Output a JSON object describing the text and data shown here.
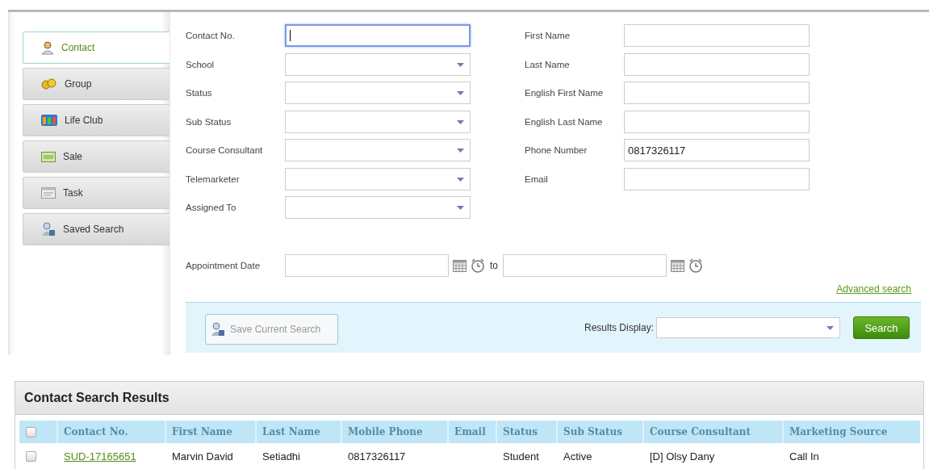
{
  "tabs": [
    {
      "label": "Contact",
      "selected": true
    },
    {
      "label": "Group",
      "selected": false
    },
    {
      "label": "Life Club",
      "selected": false
    },
    {
      "label": "Sale",
      "selected": false
    },
    {
      "label": "Task",
      "selected": false
    },
    {
      "label": "Saved Search",
      "selected": false
    }
  ],
  "form": {
    "left_fields": [
      {
        "label": "Contact No.",
        "kind": "text",
        "focused": true
      },
      {
        "label": "School",
        "kind": "select",
        "focused": false
      },
      {
        "label": "Status",
        "kind": "select",
        "focused": false
      },
      {
        "label": "Sub Status",
        "kind": "select",
        "focused": false
      },
      {
        "label": "Course Consultant",
        "kind": "select",
        "focused": false
      },
      {
        "label": "Telemarketer",
        "kind": "select",
        "focused": false
      },
      {
        "label": "Assigned To",
        "kind": "select",
        "focused": false
      }
    ],
    "right_fields": [
      {
        "label": "First Name",
        "kind": "text",
        "focused": false
      },
      {
        "label": "Last Name",
        "kind": "text",
        "focused": false
      },
      {
        "label": "English First Name",
        "kind": "text",
        "focused": false
      },
      {
        "label": "English Last Name",
        "kind": "text",
        "focused": false
      },
      {
        "label": "Phone Number",
        "kind": "text",
        "value": "0817326117",
        "focused": false
      },
      {
        "label": "Email",
        "kind": "text",
        "focused": false
      }
    ],
    "appointment": {
      "label": "Appointment Date",
      "to_label": "to"
    },
    "advanced_link": "Advanced search"
  },
  "action_bar": {
    "save_button": {
      "label": "Save Current Search",
      "disabled": true
    },
    "results_display_label": "Results Display:",
    "search_button": "Search"
  },
  "results": {
    "title": "Contact Search Results",
    "select_all_checked": false,
    "columns": [
      "Contact No.",
      "First Name",
      "Last Name",
      "Mobile Phone",
      "Email",
      "Status",
      "Sub Status",
      "Course Consultant",
      "Marketing Source"
    ],
    "rows": [
      {
        "checked": false,
        "cells": [
          "SUD-17165651",
          "Marvin David",
          "Setiadhi",
          "0817326117",
          "",
          "Student",
          "Active",
          "[D] Olsy Dany",
          "Call In"
        ]
      }
    ]
  }
}
